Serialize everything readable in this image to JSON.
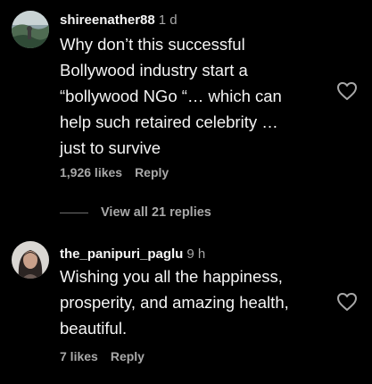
{
  "comments": [
    {
      "username": "shireenather88",
      "time": "1 d",
      "text": "Why don’t this successful\nBollywood industry start a\n“bollywood NGo “… which can\nhelp such retaired celebrity …\njust to survive",
      "likes": "1,926 likes",
      "reply_label": "Reply",
      "avatar_icon": "landscape-avatar",
      "like_icon": "heart-outline-icon"
    },
    {
      "username": "the_panipuri_paglu",
      "time": "9 h",
      "text": "Wishing you all the happiness,\nprosperity, and amazing health,\nbeautiful.",
      "likes": "7 likes",
      "reply_label": "Reply",
      "avatar_icon": "woman-portrait-avatar",
      "like_icon": "heart-outline-icon"
    }
  ],
  "view_replies": "View all 21 replies",
  "colors": {
    "background": "#000000",
    "primary_text": "#f5f5f5",
    "secondary_text": "#a8a8a8"
  }
}
